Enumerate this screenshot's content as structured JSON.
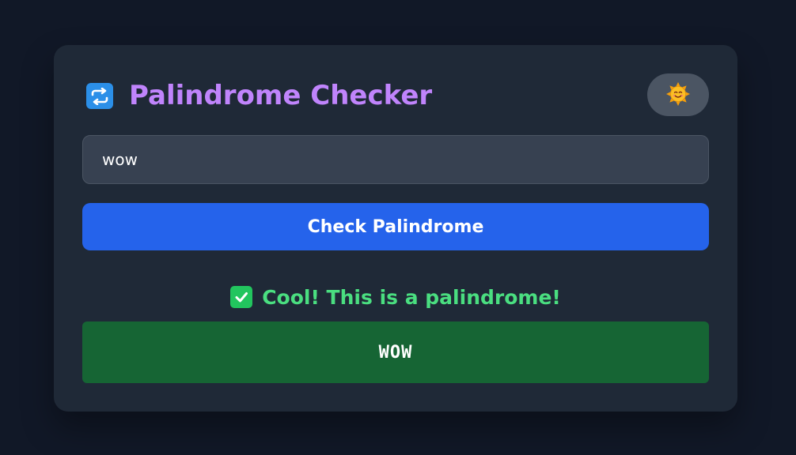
{
  "app": {
    "title": "Palindrome Checker",
    "title_icon": "repeat-arrows-icon",
    "theme_toggle_icon": "sun-face-icon"
  },
  "input": {
    "value": "wow",
    "placeholder": ""
  },
  "actions": {
    "check_label": "Check Palindrome"
  },
  "result": {
    "status_icon": "check-mark-icon",
    "message": "Cool! This is a palindrome!",
    "reversed": "WOW"
  },
  "colors": {
    "background": "#111827",
    "card": "#1f2937",
    "title": "#c084fc",
    "button": "#2563eb",
    "success_text": "#4ade80",
    "success_box": "#166534",
    "toggle": "#4b5563"
  }
}
